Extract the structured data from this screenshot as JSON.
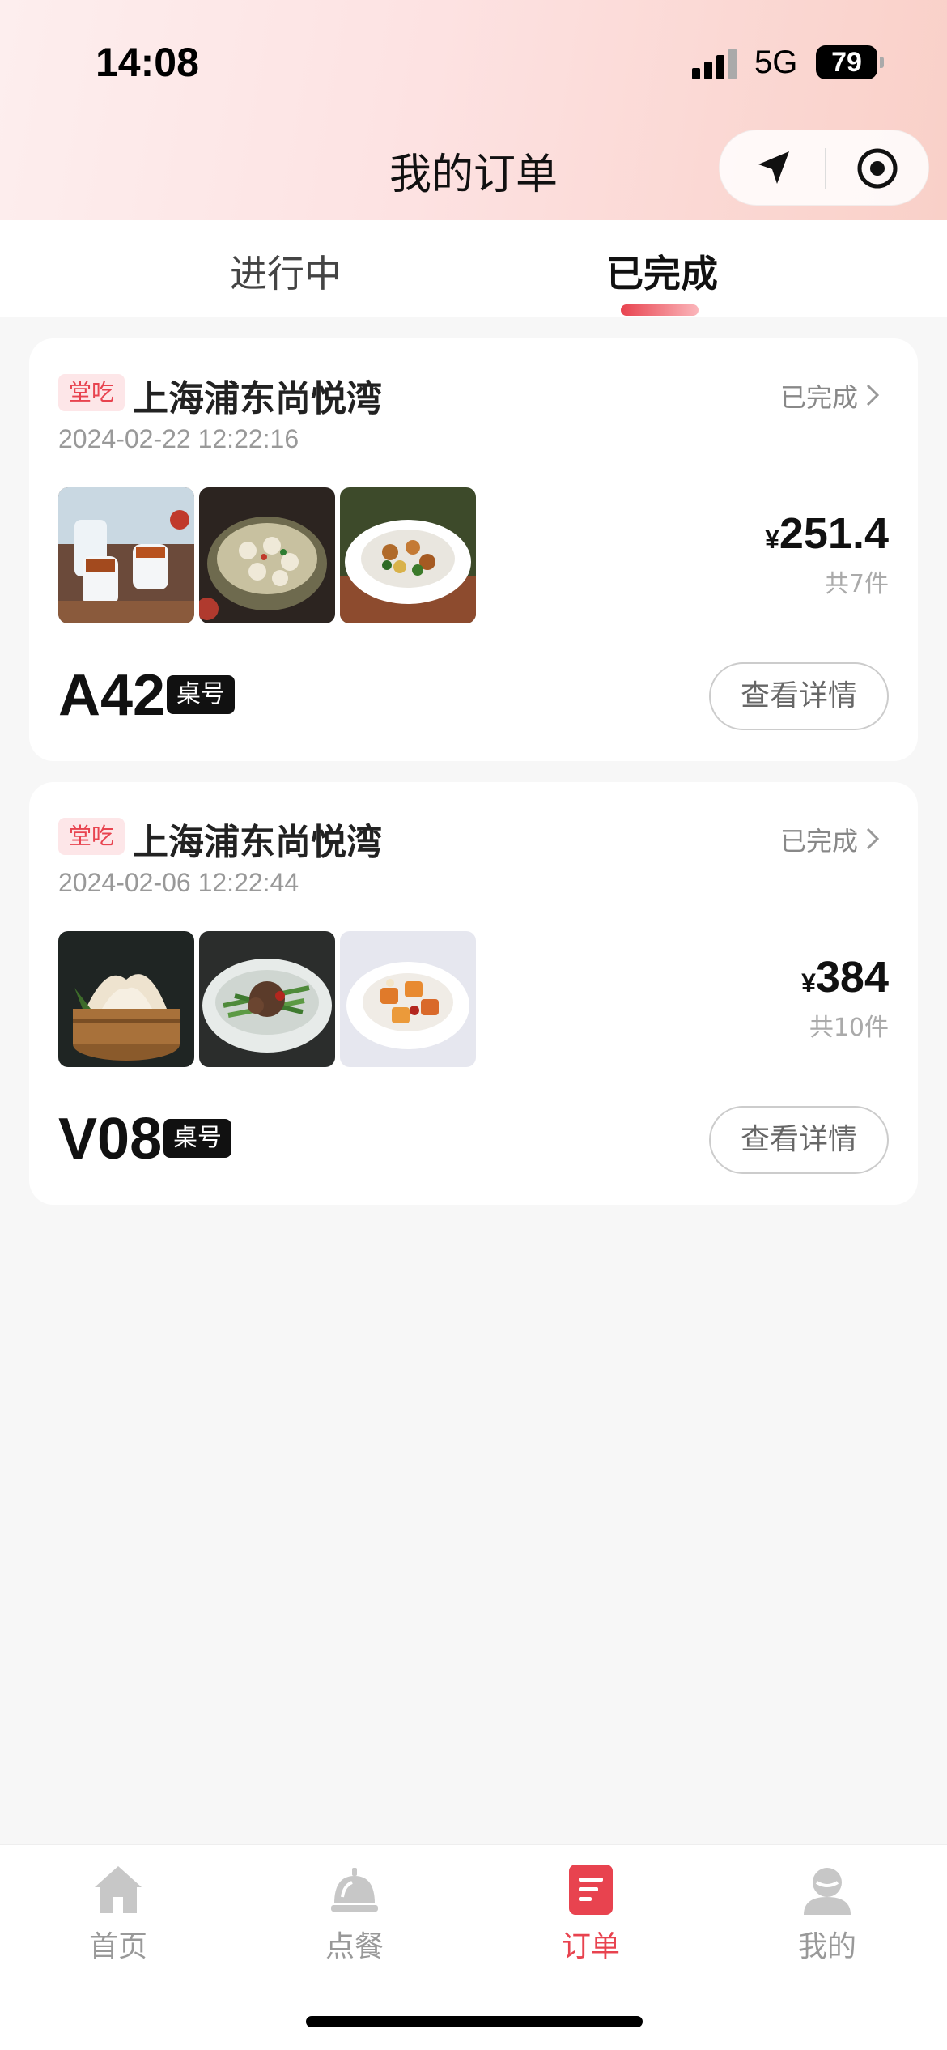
{
  "status_bar": {
    "time": "14:08",
    "network": "5G",
    "battery": "79"
  },
  "header": {
    "title": "我的订单"
  },
  "tabs": [
    {
      "label": "进行中",
      "active": false
    },
    {
      "label": "已完成",
      "active": true
    }
  ],
  "orders": [
    {
      "dine_type": "堂吃",
      "store": "上海浦东尚悦湾",
      "status": "已完成",
      "time": "2024-02-22 12:22:16",
      "price_symbol": "¥",
      "price": "251.4",
      "count": "共7件",
      "table_no": "A42",
      "table_tag": "桌号",
      "detail_label": "查看详情"
    },
    {
      "dine_type": "堂吃",
      "store": "上海浦东尚悦湾",
      "status": "已完成",
      "time": "2024-02-06 12:22:44",
      "price_symbol": "¥",
      "price": "384",
      "count": "共10件",
      "table_no": "V08",
      "table_tag": "桌号",
      "detail_label": "查看详情"
    }
  ],
  "tabbar": [
    {
      "label": "首页",
      "icon": "home-icon",
      "active": false
    },
    {
      "label": "点餐",
      "icon": "service-bell-icon",
      "active": false
    },
    {
      "label": "订单",
      "icon": "order-list-icon",
      "active": true
    },
    {
      "label": "我的",
      "icon": "profile-icon",
      "active": false
    }
  ],
  "colors": {
    "accent": "#e8434f",
    "badge_bg": "#fde6e8"
  }
}
